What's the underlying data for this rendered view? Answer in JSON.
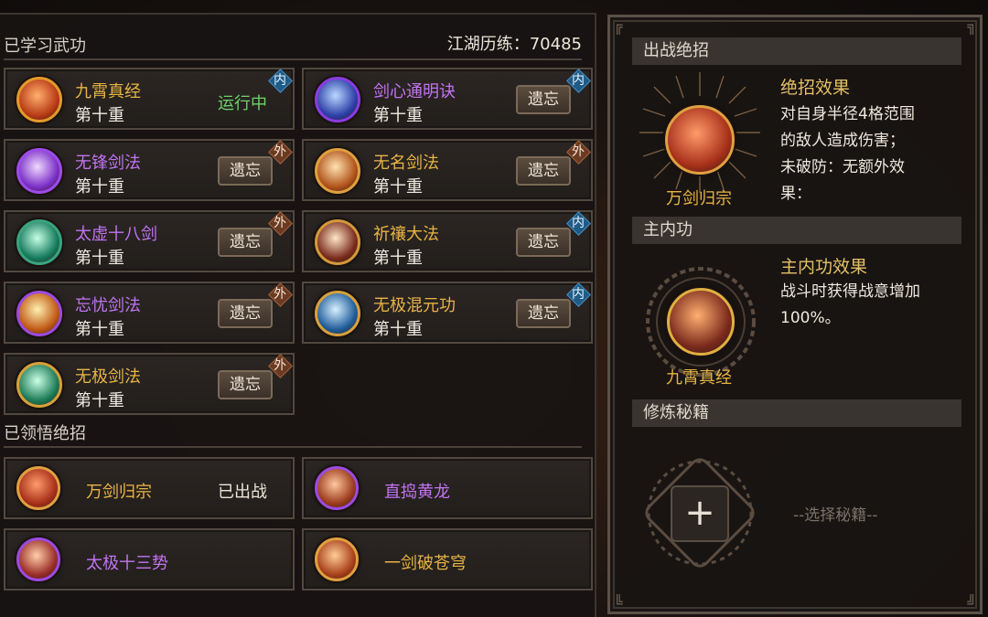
{
  "learned": {
    "title": "已学习武功",
    "lianli": "江湖历练：70485",
    "items": [
      {
        "name": "九霄真经",
        "level": "第十重",
        "status": "运行中",
        "tag": "内",
        "name_color": "gold"
      },
      {
        "name": "剑心通明诀",
        "level": "第十重",
        "button": "遗忘",
        "tag": "内",
        "name_color": "purple"
      },
      {
        "name": "无锋剑法",
        "level": "第十重",
        "button": "遗忘",
        "tag": "外",
        "name_color": "purple"
      },
      {
        "name": "无名剑法",
        "level": "第十重",
        "button": "遗忘",
        "tag": "外",
        "name_color": "gold"
      },
      {
        "name": "太虚十八剑",
        "level": "第十重",
        "button": "遗忘",
        "tag": "外",
        "name_color": "purple"
      },
      {
        "name": "祈禳大法",
        "level": "第十重",
        "button": "遗忘",
        "tag": "内",
        "name_color": "gold"
      },
      {
        "name": "忘忧剑法",
        "level": "第十重",
        "button": "遗忘",
        "tag": "外",
        "name_color": "purple"
      },
      {
        "name": "无极混元功",
        "level": "第十重",
        "button": "遗忘",
        "tag": "内",
        "name_color": "gold"
      },
      {
        "name": "无极剑法",
        "level": "第十重",
        "button": "遗忘",
        "tag": "外",
        "name_color": "gold"
      }
    ]
  },
  "ultimates": {
    "title": "已领悟绝招",
    "items": [
      {
        "name": "万剑归宗",
        "status": "已出战",
        "name_color": "gold"
      },
      {
        "name": "直捣黄龙",
        "name_color": "purple"
      },
      {
        "name": "太极十三势",
        "name_color": "purple"
      },
      {
        "name": "一剑破苍穹",
        "name_color": "gold"
      }
    ]
  },
  "right": {
    "battle_ult": {
      "header": "出战绝招",
      "effect_title": "绝招效果",
      "effect_text": "对自身半径4格范围\n的敌人造成伤害；\n未破防：无额外效\n果：",
      "caption": "万剑归宗"
    },
    "main_neigong": {
      "header": "主内功",
      "effect_title": "主内功效果",
      "effect_text": "战斗时获得战意增加\n100%。",
      "caption": "九霄真经"
    },
    "manual": {
      "header": "修炼秘籍",
      "plus": "+",
      "placeholder": "--选择秘籍--"
    }
  },
  "colors": {
    "gold": "#e8b444",
    "purple": "#c274f2",
    "running_green": "#6fd26b"
  },
  "icons": [
    "jiuxiao-skill-icon",
    "jianxin-skill-icon",
    "wufeng-skill-icon",
    "wuming-skill-icon",
    "taixu-skill-icon",
    "qirang-skill-icon",
    "wangyou-skill-icon",
    "wuji-hunyuan-skill-icon",
    "wuji-sword-skill-icon"
  ]
}
